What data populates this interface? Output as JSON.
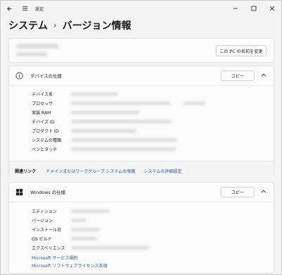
{
  "app": {
    "title": "設定"
  },
  "titlebar": {
    "back_icon": "back-arrow-icon",
    "menu_icon": "hamburger-icon"
  },
  "window_controls": {
    "minimize": "minimize-icon",
    "maximize": "maximize-icon",
    "close": "close-icon"
  },
  "breadcrumb": {
    "parent": "システム",
    "separator": "›",
    "current": "バージョン情報"
  },
  "pc_card": {
    "rename_label": "この PC の名前を変更"
  },
  "device_specs": {
    "title": "デバイスの仕様",
    "copy_label": "コピー",
    "rows": [
      {
        "label": "デバイス名"
      },
      {
        "label": "プロセッサ"
      },
      {
        "label": "実装 RAM"
      },
      {
        "label": "デバイス ID"
      },
      {
        "label": "プロダクト ID"
      },
      {
        "label": "システムの種類"
      },
      {
        "label": "ペンとタッチ"
      }
    ]
  },
  "related_links": {
    "label": "関連リンク",
    "links": [
      "ドメインまたはワークグループ",
      "システムの保護",
      "システムの詳細設定"
    ]
  },
  "windows_specs": {
    "title": "Windows の仕様",
    "copy_label": "コピー",
    "rows": [
      {
        "label": "エディション"
      },
      {
        "label": "バージョン"
      },
      {
        "label": "インストール日"
      },
      {
        "label": "OS ビルド"
      },
      {
        "label": "エクスペリエンス"
      }
    ],
    "links": [
      "Microsoft サービス規約",
      "Microsoft ソフトウェアライセンス条項"
    ]
  },
  "colors": {
    "link": "#2a5a8c",
    "background": "#f3f3f3",
    "card": "#fbfbfb"
  }
}
